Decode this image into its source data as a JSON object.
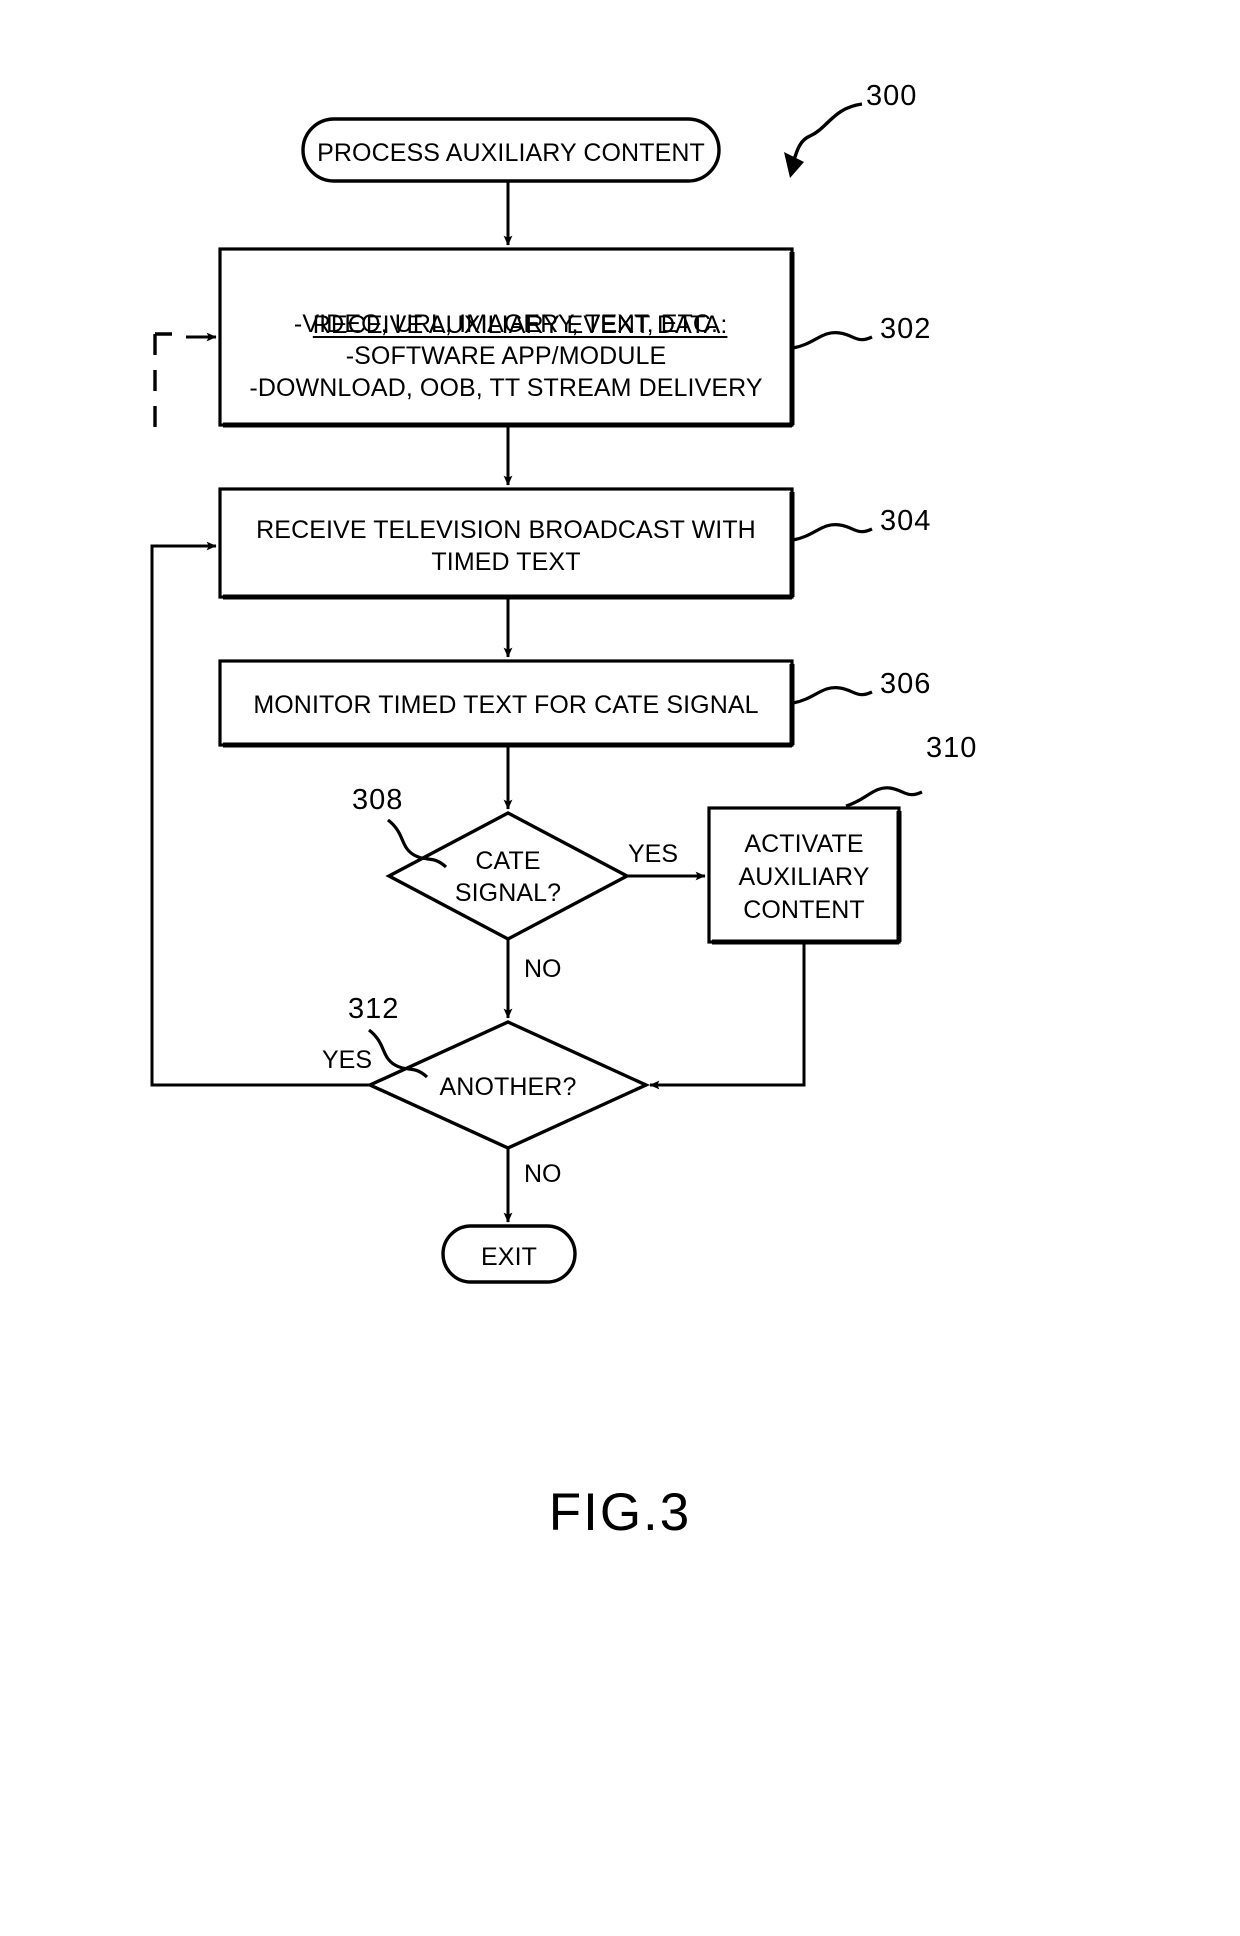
{
  "figure": {
    "caption": "FIG.3",
    "reference_numeral": "300"
  },
  "nodes": {
    "start_terminal": {
      "label": "PROCESS AUXILIARY CONTENT",
      "shape": "rounded-terminal"
    },
    "receive_auxiliary_event_data": {
      "ref": "302",
      "shape": "process",
      "title": "RECEIVE AUXILIARY EVENT DATA:",
      "lines": [
        "-VIDEO, URL, IMAGERY, TEXT, ETC.",
        "-SOFTWARE APP/MODULE",
        "-DOWNLOAD, OOB, TT STREAM DELIVERY"
      ]
    },
    "receive_television_broadcast": {
      "ref": "304",
      "shape": "process",
      "lines": [
        "RECEIVE TELEVISION BROADCAST WITH",
        "TIMED TEXT"
      ]
    },
    "monitor_timed_text": {
      "ref": "306",
      "shape": "process",
      "lines": [
        "MONITOR TIMED TEXT FOR CATE SIGNAL"
      ]
    },
    "cate_signal_decision": {
      "ref": "308",
      "shape": "decision",
      "lines": [
        "CATE",
        "SIGNAL?"
      ]
    },
    "activate_auxiliary_content": {
      "ref": "310",
      "shape": "process",
      "lines": [
        "ACTIVATE",
        "AUXILIARY",
        "CONTENT"
      ]
    },
    "another_decision": {
      "ref": "312",
      "shape": "decision",
      "lines": [
        "ANOTHER?"
      ]
    },
    "exit_terminal": {
      "label": "EXIT",
      "shape": "rounded-terminal"
    }
  },
  "edge_labels": {
    "cate_yes": "YES",
    "cate_no": "NO",
    "another_yes": "YES",
    "another_no": "NO"
  },
  "style": {
    "line_color": "#000000",
    "fill_color": "#ffffff"
  }
}
